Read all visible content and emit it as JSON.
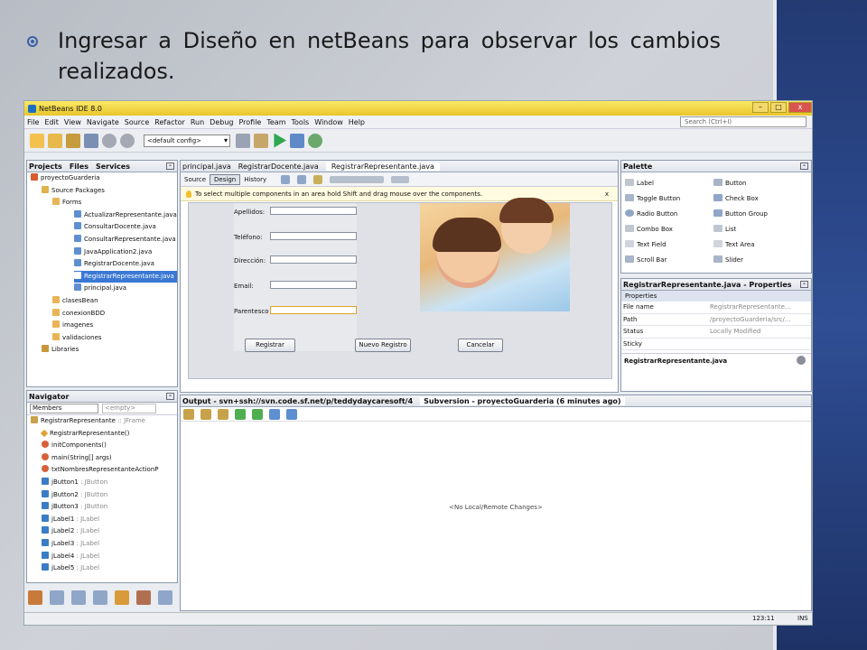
{
  "slide": {
    "headline": "Ingresar a Diseño en netBeans para observar los cambios realizados."
  },
  "window": {
    "title": "NetBeans IDE 8.0",
    "minimize": "–",
    "maximize": "□",
    "close": "x"
  },
  "menu": [
    "File",
    "Edit",
    "View",
    "Navigate",
    "Source",
    "Refactor",
    "Run",
    "Debug",
    "Profile",
    "Team",
    "Tools",
    "Window",
    "Help"
  ],
  "search": {
    "placeholder": "Search (Ctrl+I)"
  },
  "toolbar": {
    "config": "<default config>"
  },
  "projects": {
    "tabs": [
      "Projects",
      "Files",
      "Services"
    ],
    "tree": [
      "proyectoGuarderia",
      "Source Packages",
      "Forms",
      "ActualizarRepresentante.java",
      "ConsultarDocente.java",
      "ConsultarRepresentante.java",
      "JavaApplication2.java",
      "RegistrarDocente.java",
      "RegistrarRepresentante.java",
      "principal.java",
      "clasesBean",
      "conexionBDD",
      "imagenes",
      "validaciones",
      "Libraries"
    ]
  },
  "editor": {
    "tabs": [
      "principal.java",
      "RegistrarDocente.java",
      "RegistrarRepresentante.java"
    ],
    "modes": [
      "Source",
      "Design",
      "History"
    ],
    "hint": "To select multiple components in an area hold Shift and drag mouse over the components.",
    "hint_close": "x"
  },
  "form": {
    "labels": [
      "Apellidos:",
      "Teléfono:",
      "Dirección:",
      "Email:",
      "Parentesco"
    ],
    "buttons": [
      "Registrar",
      "Nuevo Registro",
      "Cancelar"
    ]
  },
  "palette": {
    "title": "Palette",
    "items": [
      "Label",
      "Button",
      "Toggle Button",
      "Check Box",
      "Radio Button",
      "Button Group",
      "Combo Box",
      "List",
      "Text Field",
      "Text Area",
      "Scroll Bar",
      "Slider"
    ]
  },
  "properties": {
    "title": "RegistrarRepresentante.java - Properties",
    "section": "Properties",
    "rows": [
      {
        "k": "File name",
        "v": "RegistrarRepresentante..."
      },
      {
        "k": "Path",
        "v": "/proyectoGuarderia/src/..."
      },
      {
        "k": "Status",
        "v": "Locally Modified"
      },
      {
        "k": "Sticky",
        "v": ""
      }
    ],
    "footer": "RegistrarRepresentante.java"
  },
  "navigator": {
    "title": "Navigator",
    "filter": "Members",
    "empty": "<empty>",
    "items": [
      {
        "name": "RegistrarRepresentante",
        "type": " :: JFrame"
      },
      {
        "name": "RegistrarRepresentante()",
        "type": ""
      },
      {
        "name": "initComponents()",
        "type": ""
      },
      {
        "name": "main(String[] args)",
        "type": ""
      },
      {
        "name": "txtNombresRepresentanteActionP",
        "type": ""
      },
      {
        "name": "jButton1",
        "type": " : JButton"
      },
      {
        "name": "jButton2",
        "type": " : JButton"
      },
      {
        "name": "jButton3",
        "type": " : JButton"
      },
      {
        "name": "jLabel1",
        "type": " : JLabel"
      },
      {
        "name": "jLabel2",
        "type": " : JLabel"
      },
      {
        "name": "jLabel3",
        "type": " : JLabel"
      },
      {
        "name": "jLabel4",
        "type": " : JLabel"
      },
      {
        "name": "jLabel5",
        "type": " : JLabel"
      }
    ]
  },
  "output": {
    "tabs": [
      "Output - svn+ssh://svn.code.sf.net/p/teddydaycaresoft/4",
      "Subversion - proyectoGuarderia (6 minutes ago)"
    ],
    "message": "<No Local/Remote Changes>"
  },
  "statusbar": {
    "position": "123:11",
    "mode": "INS"
  }
}
